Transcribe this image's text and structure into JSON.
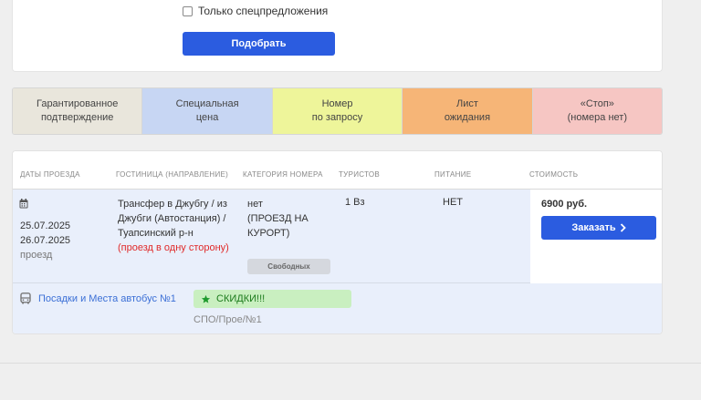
{
  "filters": {
    "special_only_label": "Только спецпредложения",
    "submit_label": "Подобрать"
  },
  "legend": [
    {
      "label_line1": "Гарантированное",
      "label_line2": "подтверждение",
      "color": "#e9e6dc"
    },
    {
      "label_line1": "Специальная",
      "label_line2": "цена",
      "color": "#c7d6f3"
    },
    {
      "label_line1": "Номер",
      "label_line2": "по запросу",
      "color": "#eef59a"
    },
    {
      "label_line1": "Лист",
      "label_line2": "ожидания",
      "color": "#f6b577"
    },
    {
      "label_line1": "«Стоп»",
      "label_line2": "(номера нет)",
      "color": "#f6c6c3"
    }
  ],
  "table": {
    "headers": {
      "dates": "Даты проезда",
      "hotel": "Гостиница (направление)",
      "category": "Категория номера",
      "tourists": "Туристов",
      "meal": "Питание",
      "price": "Стоимость"
    },
    "rows": [
      {
        "date_from": "25.07.2025",
        "date_to": "26.07.2025",
        "date_note": "проезд",
        "hotel": "Трансфер в Джубгу / из Джубги (Автостанция) / Туапсинский р-н",
        "hotel_note": "(проезд в одну сторону)",
        "category_line1": "нет",
        "category_line2": "(ПРОЕЗД НА",
        "category_line3": "КУРОРТ)",
        "free_label": "Свободных",
        "tourists": "1 Вз",
        "meal": "НЕТ",
        "price": "6900 руб.",
        "order_label": "Заказать"
      }
    ],
    "bus": {
      "link_label": "Посадки и Места автобус №1",
      "discount_label": "СКИДКИ!!!",
      "spo_label": "СПО/Прое/№1"
    }
  },
  "colors": {
    "accent": "#2b5ce0",
    "row_bg": "#e9effb",
    "discount_bg": "#c9efc0",
    "discount_star": "#1f9a2e",
    "note_red": "#e02a2a"
  }
}
